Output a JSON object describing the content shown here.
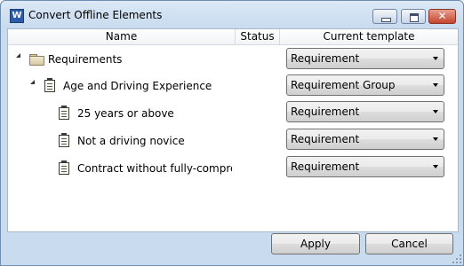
{
  "window": {
    "title": "Convert Offline Elements",
    "app_icon_letter": "W",
    "close_glyph": "✕"
  },
  "columns": {
    "name": "Name",
    "status": "Status",
    "template": "Current template"
  },
  "rows": [
    {
      "label": "Requirements",
      "icon": "folder-icon",
      "template": "Requirement",
      "status": ""
    },
    {
      "label": "Age and Driving Experience",
      "icon": "document-icon",
      "template": "Requirement Group",
      "status": ""
    },
    {
      "label": "25 years or above",
      "icon": "document-icon",
      "template": "Requirement",
      "status": ""
    },
    {
      "label": "Not a driving novice",
      "icon": "document-icon",
      "template": "Requirement",
      "status": ""
    },
    {
      "label": "Contract without fully-comprehe",
      "icon": "document-icon",
      "template": "Requirement",
      "status": ""
    }
  ],
  "buttons": {
    "apply": "Apply",
    "cancel": "Cancel"
  },
  "colors": {
    "titlebar": "#dbe8f6",
    "close_button": "#c4452e"
  }
}
